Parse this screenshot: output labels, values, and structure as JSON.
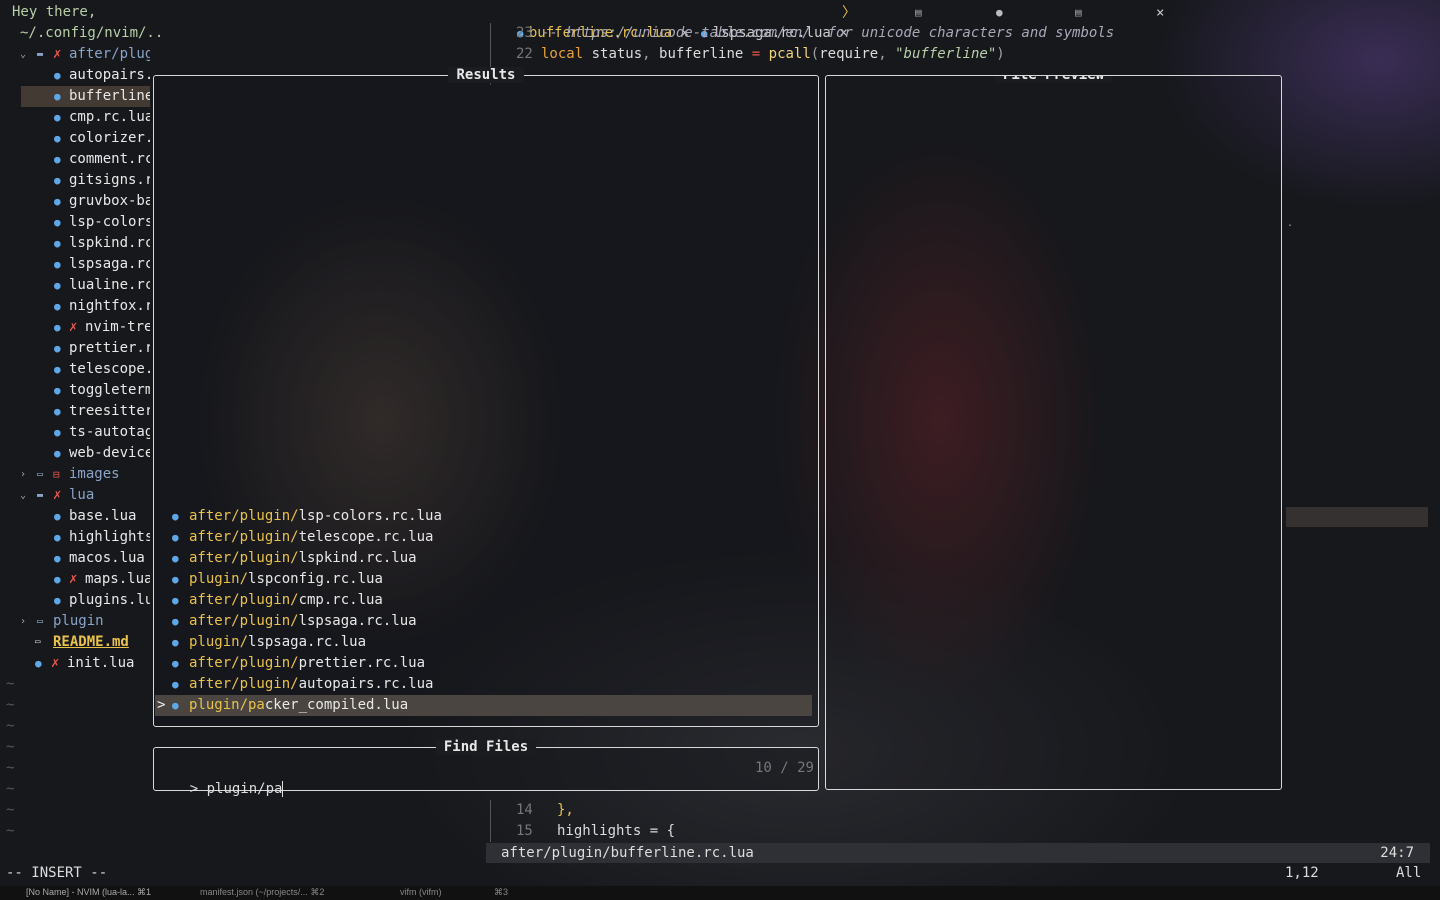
{
  "greeting": "Hey there,",
  "cwd": "~/.config/nvim/..",
  "tree": [
    {
      "indent": 0,
      "kind": "folder-open",
      "mark": "x",
      "name": "after/plugin"
    },
    {
      "indent": 1,
      "kind": "lua",
      "name": "autopairs."
    },
    {
      "indent": 1,
      "kind": "lua",
      "name": "bufferline",
      "selected": true
    },
    {
      "indent": 1,
      "kind": "lua",
      "name": "cmp.rc.lua"
    },
    {
      "indent": 1,
      "kind": "lua",
      "name": "colorizer."
    },
    {
      "indent": 1,
      "kind": "lua",
      "name": "comment.rc"
    },
    {
      "indent": 1,
      "kind": "lua",
      "name": "gitsigns.r"
    },
    {
      "indent": 1,
      "kind": "lua",
      "name": "gruvbox-ba"
    },
    {
      "indent": 1,
      "kind": "lua",
      "name": "lsp-colors"
    },
    {
      "indent": 1,
      "kind": "lua",
      "name": "lspkind.rc"
    },
    {
      "indent": 1,
      "kind": "lua",
      "name": "lspsaga.rc"
    },
    {
      "indent": 1,
      "kind": "lua",
      "name": "lualine.rc"
    },
    {
      "indent": 1,
      "kind": "lua",
      "name": "nightfox.r"
    },
    {
      "indent": 1,
      "kind": "lua",
      "mark": "x",
      "name": "nvim-tre"
    },
    {
      "indent": 1,
      "kind": "lua",
      "name": "prettier.r"
    },
    {
      "indent": 1,
      "kind": "lua",
      "name": "telescope."
    },
    {
      "indent": 1,
      "kind": "lua",
      "name": "toggleterm"
    },
    {
      "indent": 1,
      "kind": "lua",
      "name": "treesitter"
    },
    {
      "indent": 1,
      "kind": "lua",
      "name": "ts-autotag"
    },
    {
      "indent": 1,
      "kind": "lua",
      "name": "web-device"
    },
    {
      "indent": 0,
      "kind": "folder-closed",
      "mark": "box",
      "name": "images"
    },
    {
      "indent": 0,
      "kind": "folder-open",
      "mark": "x",
      "name": "lua"
    },
    {
      "indent": 1,
      "kind": "lua",
      "name": "base.lua"
    },
    {
      "indent": 1,
      "kind": "lua",
      "name": "highlights"
    },
    {
      "indent": 1,
      "kind": "lua",
      "name": "macos.lua"
    },
    {
      "indent": 1,
      "kind": "lua",
      "mark": "x",
      "name": "maps.lua"
    },
    {
      "indent": 1,
      "kind": "lua",
      "name": "plugins.lu"
    },
    {
      "indent": 0,
      "kind": "folder-closed",
      "name": "plugin"
    },
    {
      "indent": 0,
      "kind": "md",
      "name": "README.md"
    },
    {
      "indent": 0,
      "kind": "lua",
      "mark": "x",
      "name": "init.lua"
    }
  ],
  "tildes": [
    "~",
    "~",
    "~",
    "~",
    "~",
    "~",
    "~",
    "~"
  ],
  "tabs": [
    {
      "name": "bufferline.rc.lua",
      "close": "×"
    },
    {
      "name": "lspsaga.rc.lua",
      "close": "×"
    }
  ],
  "tab_more": "〉",
  "editor_top": {
    "line23_num": "23",
    "line23_text": "-- https://unicode-table.com/en/  for unicode characters and symbols",
    "line22_num": "22"
  },
  "results": {
    "title": "Results",
    "items": [
      {
        "pre": "after/plugin/",
        "hl": "",
        "name": "lsp-colors.rc.lua"
      },
      {
        "pre": "after/plugin/",
        "hl": "",
        "name": "telescope.rc.lua"
      },
      {
        "pre": "after/plugin/",
        "hl": "",
        "name": "lspkind.rc.lua"
      },
      {
        "pre": "plugin/",
        "hl": "",
        "name": "lspconfig.rc.lua"
      },
      {
        "pre": "after/plugin/",
        "hl": "",
        "name": "cmp.rc.lua"
      },
      {
        "pre": "after/plugin/",
        "hl": "",
        "name": "lspsaga.rc.lua"
      },
      {
        "pre": "plugin/",
        "hl": "",
        "name": "lspsaga.rc.lua"
      },
      {
        "pre": "after/plugin/",
        "hl": "",
        "name": "prettier.rc.lua"
      },
      {
        "pre": "after/plugin/",
        "hl": "",
        "name": "autopairs.rc.lua"
      },
      {
        "pre": "plugin/",
        "hl": "pa",
        "name": "cker_compiled.lua",
        "selected": true
      }
    ]
  },
  "find": {
    "title": "Find Files",
    "prompt": ">",
    "query": "plugin/pa",
    "count": "10 / 29"
  },
  "preview": {
    "title": "File Preview"
  },
  "editor_bottom": {
    "line14_num": "14",
    "line14_text": "},",
    "line15_num": "15",
    "line15_text": "highlights = {"
  },
  "statusline": {
    "path": "after/plugin/bufferline.rc.lua",
    "pos": "24:7"
  },
  "mode": "-- INSERT --",
  "ruler": {
    "pos": "1,12",
    "pct": "All"
  },
  "terminal_tabs": [
    {
      "label": "[No Name] - NVIM (lua-la...",
      "key": "⌘1"
    },
    {
      "label": "manifest.json (~/projects/...",
      "key": "⌘2"
    },
    {
      "label": "vifm (vifm)",
      "key": "⌘3"
    }
  ],
  "colors": {
    "accent": "#e9c24b",
    "keyword": "#e9a23b",
    "error": "#e8584a",
    "lua_icon": "#5fa8e8"
  }
}
